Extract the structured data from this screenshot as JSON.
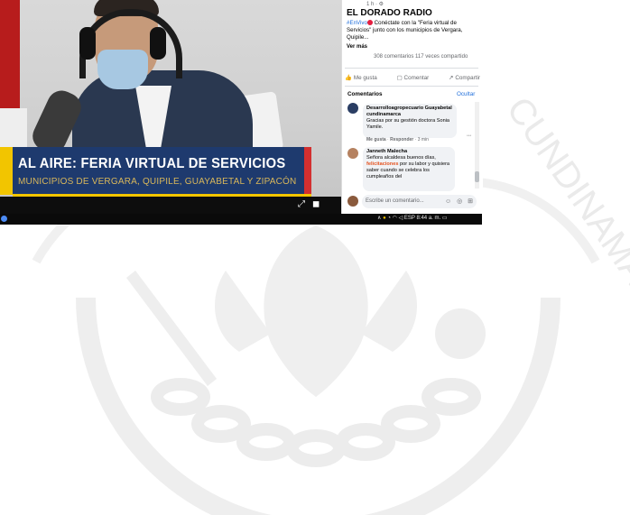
{
  "video": {
    "lower_third_title": "AL AIRE: FERIA VIRTUAL DE SERVICIOS",
    "lower_third_subtitle": "MUNICIPIOS DE VERGARA, QUIPILE, GUAYABETAL Y ZIPACÓN"
  },
  "facebook": {
    "post_time": "1 h · ⚙",
    "page_name": "EL DORADO RADIO",
    "post_hashtag": "#EnVivo",
    "post_text": " Conéctate con la \"Feria virtual de Servicios\" junto con los municipios de Vergara, Quipile...",
    "see_more": "Ver más",
    "stats": "308 comentarios  117 veces compartido",
    "actions": {
      "like": "Me gusta",
      "comment": "Comentar",
      "share": "Compartir"
    },
    "comments_header": "Comentarios",
    "hide_label": "Ocultar",
    "comments": [
      {
        "author": "Desarrolloagropecuario Guayabetal cundinamarca",
        "text": "Gracias por su gestión doctora Sonia Yamile.",
        "meta_like": "Me gusta",
        "meta_reply": "Responder",
        "meta_time": "3 min"
      },
      {
        "author": "Janneth Malecha",
        "text_before": "Señora alcaldesa buenos días, ",
        "highlight": "felicitaciones",
        "text_after": " por su labor y quisiera saber cuando se celebra los cumpleaños del"
      }
    ],
    "compose_placeholder": "Escribe un comentario...",
    "compose_icons": "☺ ◎ ⊞"
  },
  "taskbar": {
    "tray_icons": "∧",
    "language": "ESP",
    "time": "8:44 a. m."
  },
  "colors": {
    "lower_third_bg": "#1e3a6e",
    "accent_yellow": "#f2c500",
    "accent_red": "#d32f2f",
    "fb_link": "#216fdb"
  }
}
